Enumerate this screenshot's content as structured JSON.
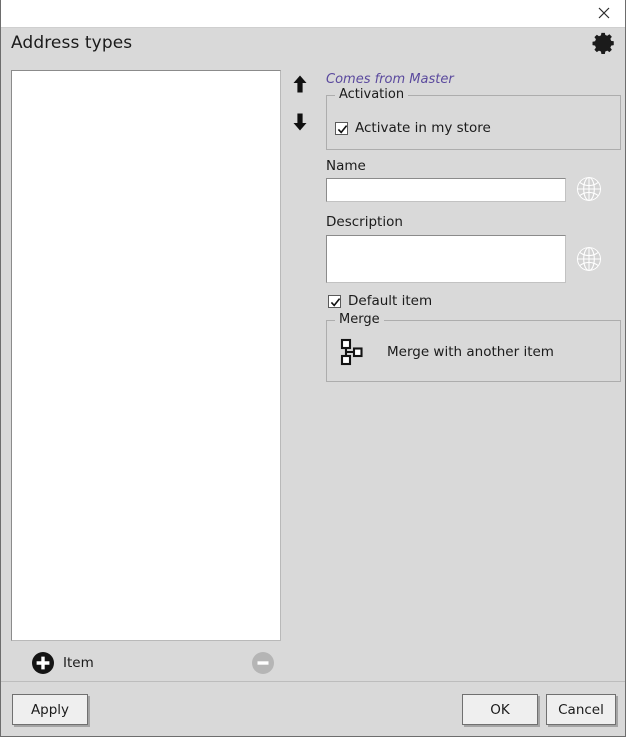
{
  "window": {
    "close_icon": "close-icon"
  },
  "header": {
    "title": "Address types",
    "settings_icon": "gear-icon"
  },
  "list_panel": {
    "items": [],
    "move_up_icon": "arrow-up-icon",
    "move_down_icon": "arrow-down-icon",
    "add_label": "Item",
    "add_icon": "plus-circle-icon",
    "remove_icon": "minus-circle-icon",
    "remove_enabled": false
  },
  "details": {
    "master_note": "Comes from Master",
    "activation": {
      "group_title": "Activation",
      "checkbox_label": "Activate in my store",
      "checked": true
    },
    "name": {
      "label": "Name",
      "value": "",
      "placeholder": "",
      "translate_icon": "globe-icon"
    },
    "description": {
      "label": "Description",
      "value": "",
      "placeholder": "",
      "translate_icon": "globe-icon"
    },
    "default_item": {
      "label": "Default item",
      "checked": true
    },
    "merge": {
      "group_title": "Merge",
      "action_label": "Merge with another item",
      "icon": "merge-nodes-icon"
    }
  },
  "footer": {
    "apply_label": "Apply",
    "ok_label": "OK",
    "cancel_label": "Cancel"
  },
  "colors": {
    "dialog_bg": "#d9d9d9",
    "titlebar_bg": "#ffffff",
    "master_note": "#5b4a9e",
    "button_bg": "#efefef",
    "border": "#adadad",
    "text": "#1b1b1b"
  }
}
